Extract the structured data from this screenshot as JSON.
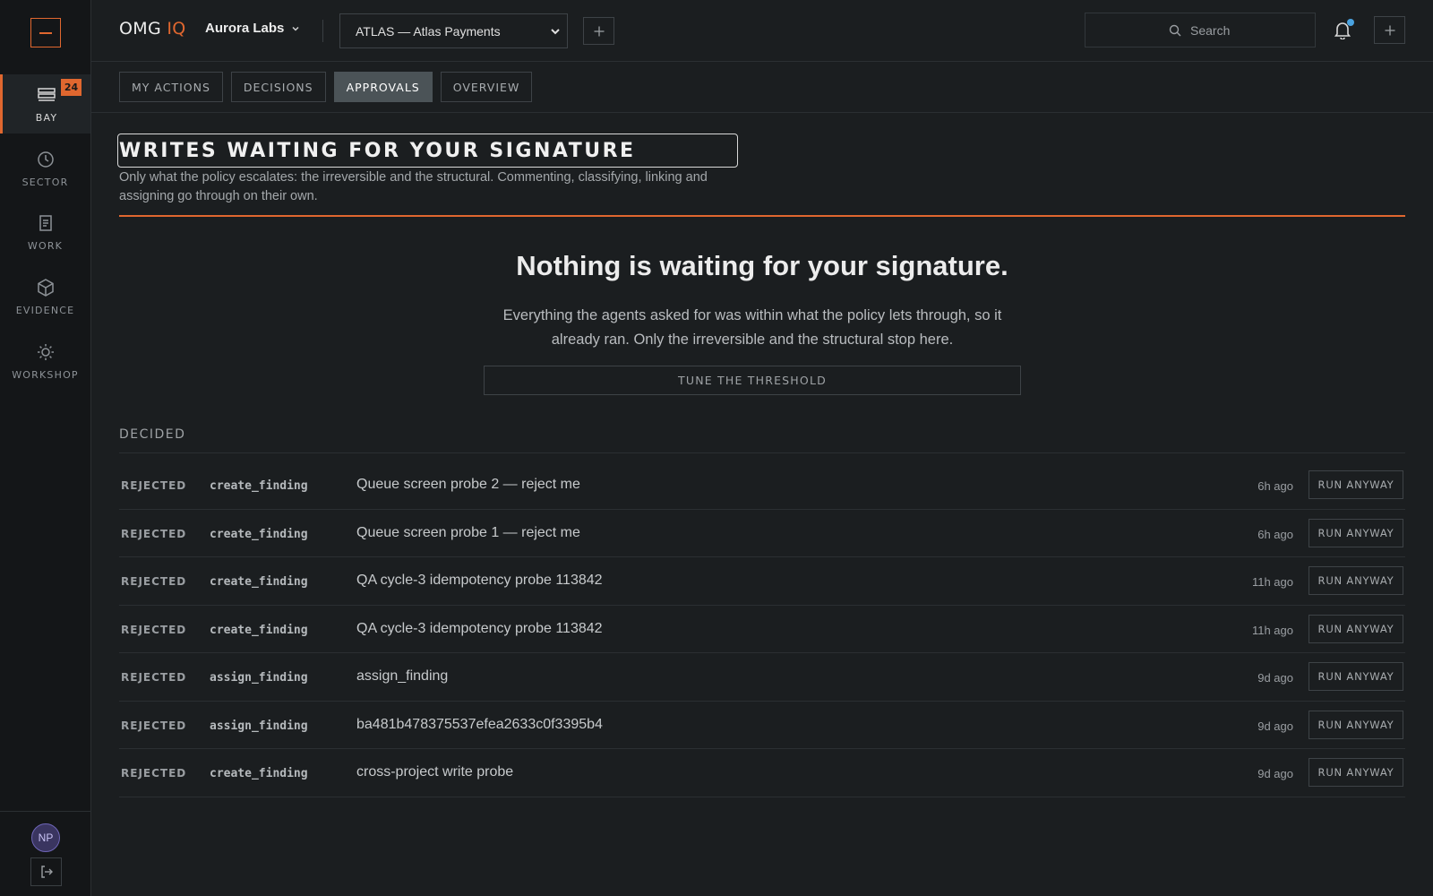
{
  "brand": {
    "name": "OMG",
    "accent": "IQ",
    "accent_color": "#e0672f"
  },
  "org": {
    "name": "Aurora Labs"
  },
  "project": {
    "selected": "ATLAS — Atlas Payments"
  },
  "search": {
    "placeholder": "Search"
  },
  "sidebar": {
    "items": [
      {
        "label": "BAY",
        "icon": "inbox-icon",
        "badge": "24",
        "active": true
      },
      {
        "label": "SECTOR",
        "icon": "clock-icon"
      },
      {
        "label": "WORK",
        "icon": "document-icon"
      },
      {
        "label": "EVIDENCE",
        "icon": "cube-icon"
      },
      {
        "label": "WORKSHOP",
        "icon": "sun-icon"
      }
    ],
    "user_initials": "NP"
  },
  "tabs": [
    {
      "label": "MY ACTIONS"
    },
    {
      "label": "DECISIONS"
    },
    {
      "label": "APPROVALS",
      "active": true
    },
    {
      "label": "OVERVIEW"
    }
  ],
  "page": {
    "title": "WRITES WAITING FOR YOUR SIGNATURE",
    "subtitle": "Only what the policy escalates: the irreversible and the structural. Commenting, classifying, linking and assigning go through on their own."
  },
  "empty_state": {
    "title": "Nothing is waiting for your signature.",
    "body": "Everything the agents asked for was within what the policy lets through, so it already ran. Only the irreversible and the structural stop here.",
    "button": "TUNE THE THRESHOLD"
  },
  "decided": {
    "label": "DECIDED",
    "action_label": "RUN ANYWAY",
    "rows": [
      {
        "status": "REJECTED",
        "tool": "create_finding",
        "title": "Queue screen probe 2 — reject me",
        "time": "6h ago"
      },
      {
        "status": "REJECTED",
        "tool": "create_finding",
        "title": "Queue screen probe 1 — reject me",
        "time": "6h ago"
      },
      {
        "status": "REJECTED",
        "tool": "create_finding",
        "title": "QA cycle-3 idempotency probe 113842",
        "time": "11h ago"
      },
      {
        "status": "REJECTED",
        "tool": "create_finding",
        "title": "QA cycle-3 idempotency probe 113842",
        "time": "11h ago"
      },
      {
        "status": "REJECTED",
        "tool": "assign_finding",
        "title": "assign_finding",
        "time": "9d ago"
      },
      {
        "status": "REJECTED",
        "tool": "assign_finding",
        "title": "ba481b478375537efea2633c0f3395b4",
        "time": "9d ago"
      },
      {
        "status": "REJECTED",
        "tool": "create_finding",
        "title": "cross-project write probe",
        "time": "9d ago"
      }
    ]
  }
}
